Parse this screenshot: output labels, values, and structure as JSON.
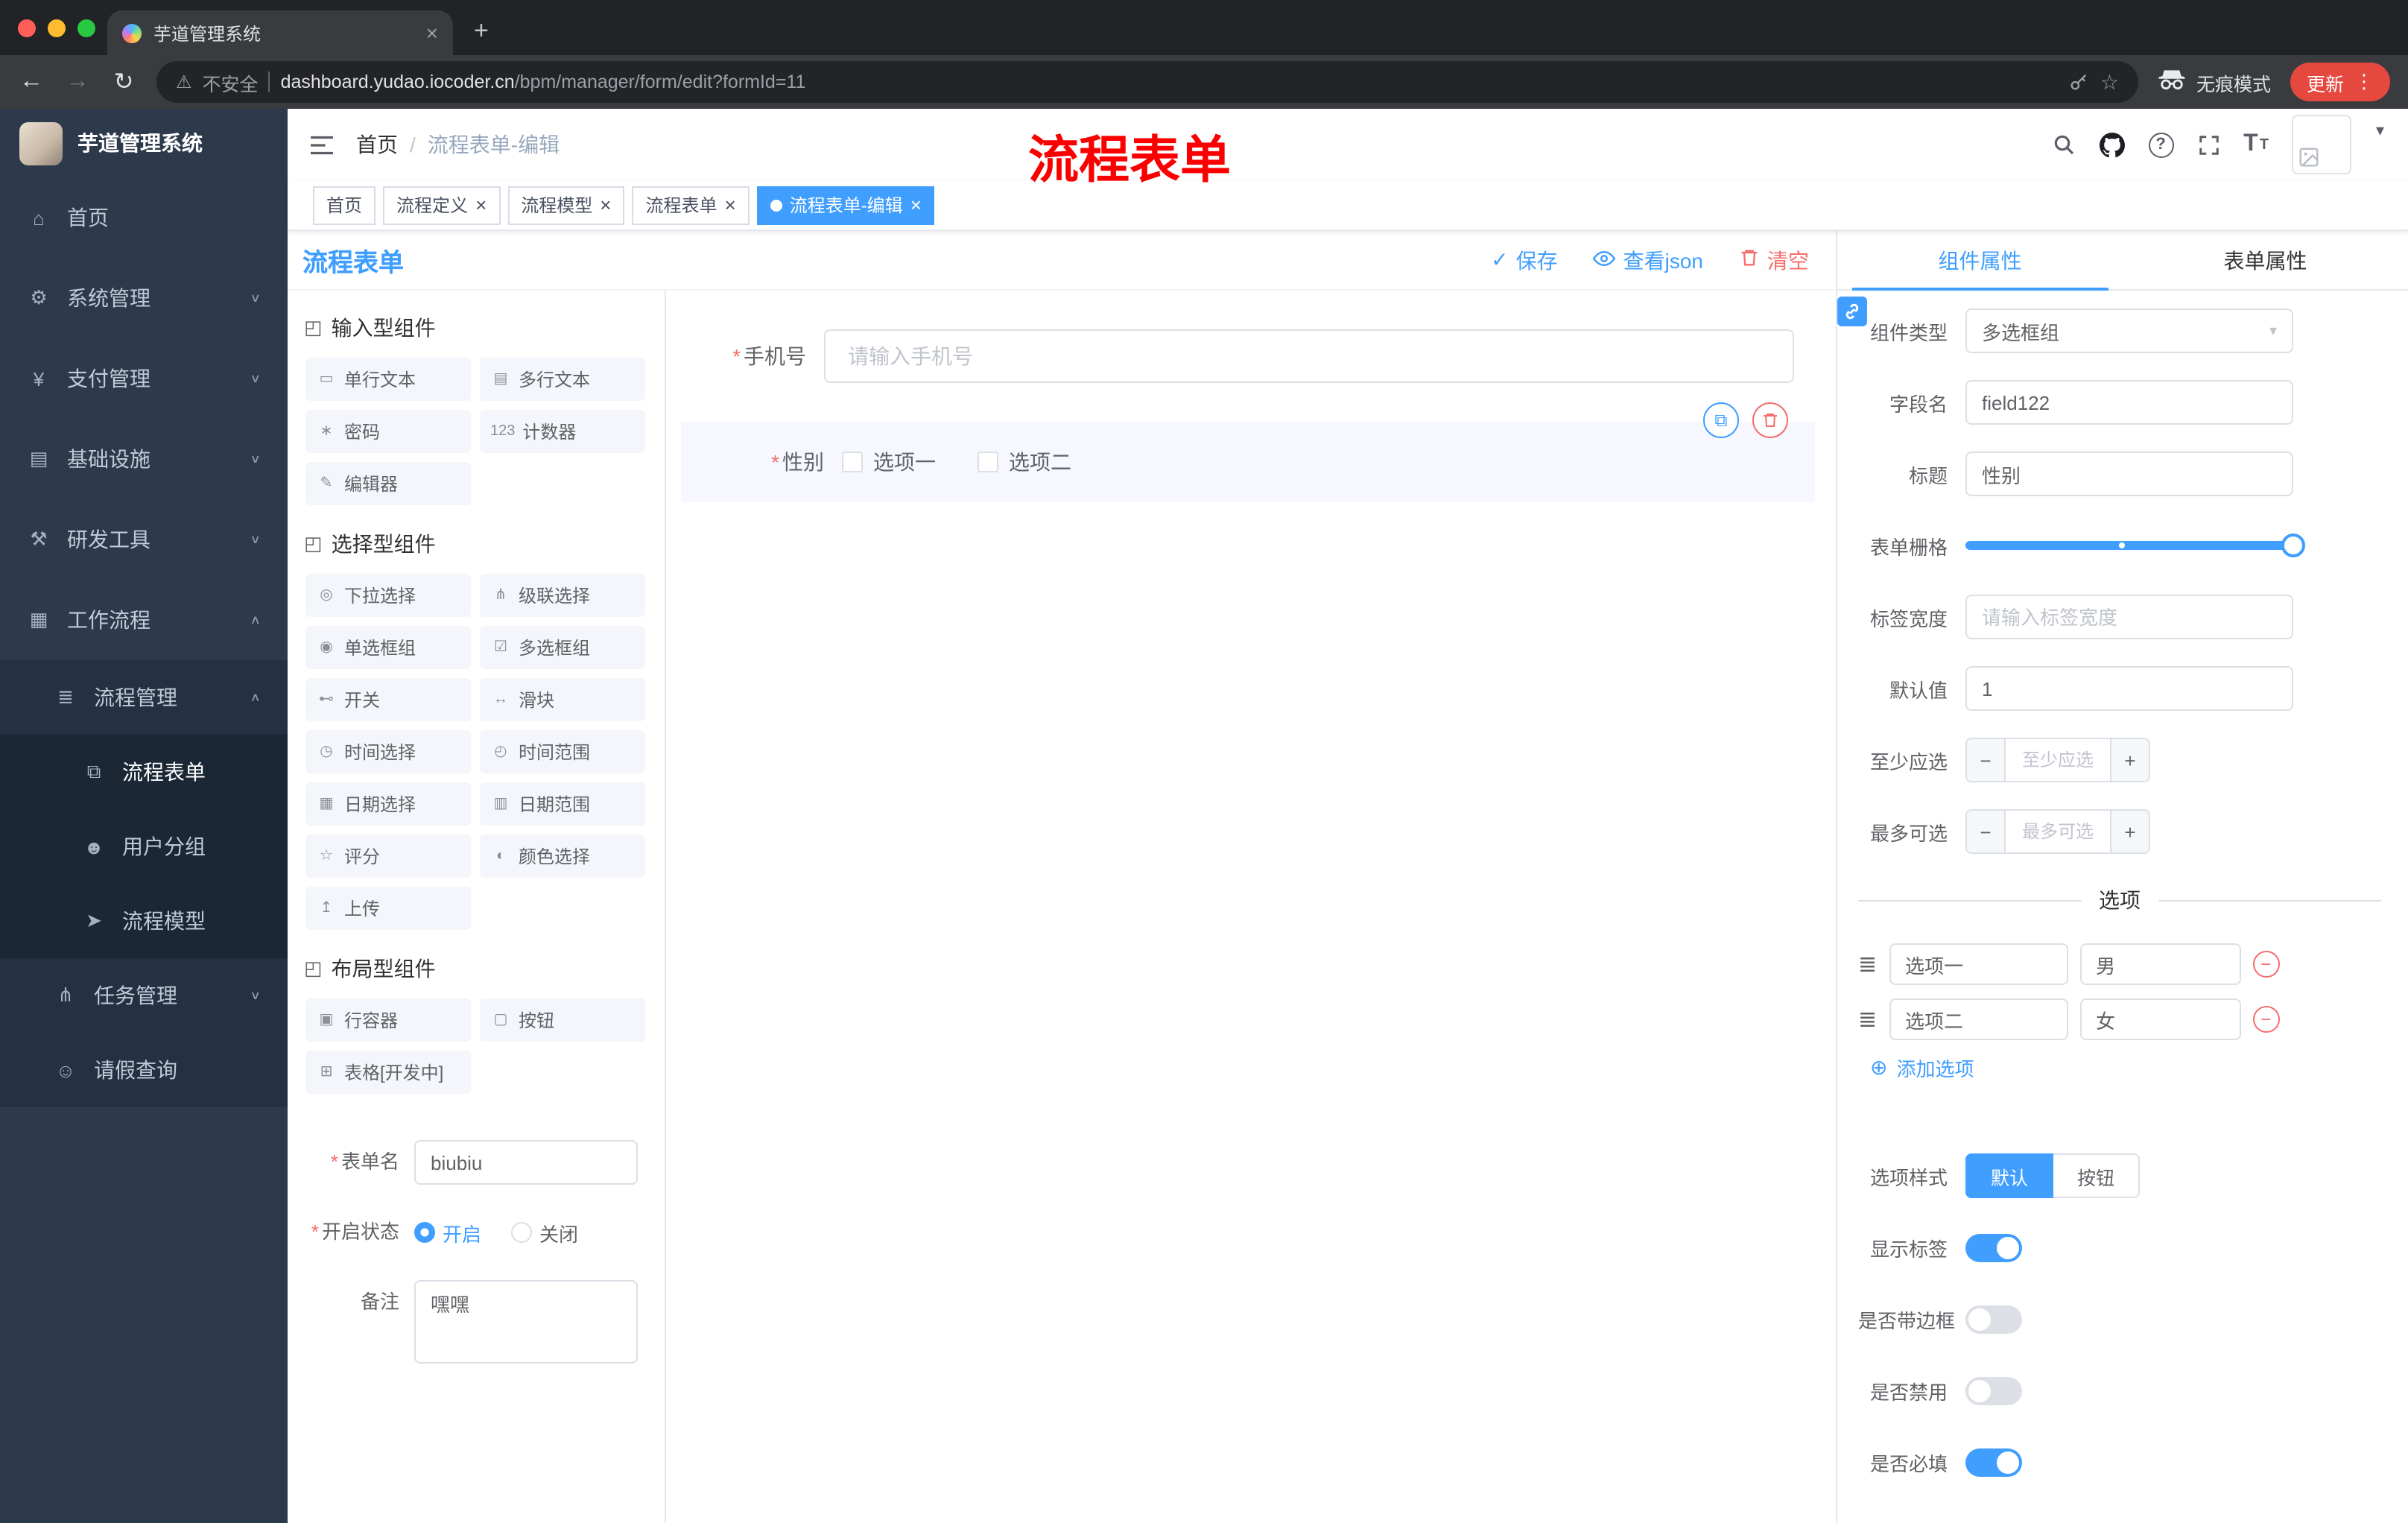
{
  "colors": {
    "accent": "#409eff",
    "danger": "#f56c6c",
    "overlay_red": "#fb0000"
  },
  "symbols": {
    "required": "*",
    "close": "×",
    "plus": "+",
    "minus": "−",
    "dots": "⋮",
    "warning": "⚠",
    "star": "☆",
    "back": "←",
    "forward": "→",
    "reload": "↻",
    "caret": "▾",
    "check": "✓",
    "question": "?",
    "font_big": "T",
    "font_small": "T",
    "chevron_down": "∨",
    "chevron_up": "∧",
    "add_circle": "⊕",
    "drag": "≣",
    "copy": "⧉",
    "select_arrow": "▾"
  },
  "browser": {
    "tab_title": "芋道管理系统",
    "security_label": "不安全",
    "url_host": "dashboard.yudao.iocoder.cn",
    "url_path": "/bpm/manager/form/edit?formId=11",
    "incognito_label": "无痕模式",
    "update_label": "更新"
  },
  "sidebar": {
    "logo_title": "芋道管理系统",
    "menu": [
      {
        "label": "首页",
        "icon": "home",
        "level": 0
      },
      {
        "label": "系统管理",
        "icon": "gear",
        "level": 0,
        "arrow": "down"
      },
      {
        "label": "支付管理",
        "icon": "payment",
        "level": 0,
        "arrow": "down"
      },
      {
        "label": "基础设施",
        "icon": "infrastructure",
        "level": 0,
        "arrow": "down"
      },
      {
        "label": "研发工具",
        "icon": "devtools",
        "level": 0,
        "arrow": "down"
      },
      {
        "label": "工作流程",
        "icon": "workflow",
        "level": 0,
        "arrow": "up"
      },
      {
        "label": "流程管理",
        "icon": "process-management",
        "level": 1,
        "arrow": "up"
      },
      {
        "label": "流程表单",
        "icon": "process-form",
        "level": 2,
        "active": true
      },
      {
        "label": "用户分组",
        "icon": "user-group",
        "level": 2
      },
      {
        "label": "流程模型",
        "icon": "process-model",
        "level": 2
      },
      {
        "label": "任务管理",
        "icon": "task-management",
        "level": 1,
        "arrow": "down"
      },
      {
        "label": "请假查询",
        "icon": "leave-query",
        "level": 1
      }
    ]
  },
  "navbar": {
    "breadcrumb_root": "首页",
    "breadcrumb_separator": "/",
    "breadcrumb_current": "流程表单-编辑",
    "overlay_title": "流程表单"
  },
  "tags": [
    {
      "label": "首页",
      "closable": false,
      "active": false
    },
    {
      "label": "流程定义",
      "closable": true,
      "active": false
    },
    {
      "label": "流程模型",
      "closable": true,
      "active": false
    },
    {
      "label": "流程表单",
      "closable": true,
      "active": false
    },
    {
      "label": "流程表单-编辑",
      "closable": true,
      "active": true
    }
  ],
  "designer": {
    "title": "流程表单",
    "actions": {
      "save": "保存",
      "view_json": "查看json",
      "clear": "清空"
    },
    "groups": [
      {
        "title": "输入型组件",
        "items": [
          {
            "label": "单行文本",
            "icon": "single-line-text"
          },
          {
            "label": "多行文本",
            "icon": "multi-line-text"
          },
          {
            "label": "密码",
            "icon": "password"
          },
          {
            "label": "计数器",
            "icon": "counter"
          },
          {
            "label": "编辑器",
            "icon": "editor"
          }
        ]
      },
      {
        "title": "选择型组件",
        "items": [
          {
            "label": "下拉选择",
            "icon": "select"
          },
          {
            "label": "级联选择",
            "icon": "cascader"
          },
          {
            "label": "单选框组",
            "icon": "radio-group"
          },
          {
            "label": "多选框组",
            "icon": "checkbox-group"
          },
          {
            "label": "开关",
            "icon": "switch"
          },
          {
            "label": "滑块",
            "icon": "slider"
          },
          {
            "label": "时间选择",
            "icon": "time-picker"
          },
          {
            "label": "时间范围",
            "icon": "time-range"
          },
          {
            "label": "日期选择",
            "icon": "date-picker"
          },
          {
            "label": "日期范围",
            "icon": "date-range"
          },
          {
            "label": "评分",
            "icon": "rate"
          },
          {
            "label": "颜色选择",
            "icon": "color-picker"
          },
          {
            "label": "上传",
            "icon": "upload"
          }
        ]
      },
      {
        "title": "布局型组件",
        "items": [
          {
            "label": "行容器",
            "icon": "row-container"
          },
          {
            "label": "按钮",
            "icon": "button"
          },
          {
            "label": "表格[开发中]",
            "icon": "table"
          }
        ]
      }
    ],
    "meta": {
      "form_name_label": "表单名",
      "form_name_value": "biubiu",
      "status_label": "开启状态",
      "status_on": "开启",
      "status_off": "关闭",
      "status_selected": "开启",
      "remark_label": "备注",
      "remark_value": "嘿嘿"
    },
    "canvas": {
      "phone_label": "手机号",
      "phone_placeholder": "请输入手机号",
      "gender_label": "性别",
      "gender_options": [
        "选项一",
        "选项二"
      ]
    }
  },
  "props": {
    "tab_component": "组件属性",
    "tab_form": "表单属性",
    "active_tab": "组件属性",
    "component_type_label": "组件类型",
    "component_type_value": "多选框组",
    "field_name_label": "字段名",
    "field_name_value": "field122",
    "title_label": "标题",
    "title_value": "性别",
    "grid_label": "表单栅格",
    "label_width_label": "标签宽度",
    "label_width_placeholder": "请输入标签宽度",
    "default_label": "默认值",
    "default_value": "1",
    "min_label": "至少应选",
    "min_placeholder": "至少应选",
    "max_label": "最多可选",
    "max_placeholder": "最多可选",
    "options_divider": "选项",
    "options": [
      {
        "name": "选项一",
        "value": "男"
      },
      {
        "name": "选项二",
        "value": "女"
      }
    ],
    "add_option_label": "添加选项",
    "option_style_label": "选项样式",
    "option_style_default": "默认",
    "option_style_button": "按钮",
    "option_style_active": "默认",
    "switches": [
      {
        "label": "显示标签",
        "on": true
      },
      {
        "label": "是否带边框",
        "on": false
      },
      {
        "label": "是否禁用",
        "on": false
      },
      {
        "label": "是否必填",
        "on": true
      }
    ]
  },
  "icon_glyphs": {
    "home": "⌂",
    "gear": "⚙",
    "payment": "¥",
    "infrastructure": "▤",
    "devtools": "⚒",
    "workflow": "▦",
    "process-management": "≣",
    "process-form": "⧉",
    "user-group": "☻",
    "process-model": "➤",
    "task-management": "⋔",
    "leave-query": "☺",
    "group": "◰",
    "single-line-text": "▭",
    "multi-line-text": "▤",
    "password": "∗",
    "counter": "123",
    "editor": "✎",
    "select": "◎",
    "cascader": "⋔",
    "radio-group": "◉",
    "checkbox-group": "☑",
    "switch": "⊷",
    "slider": "↔",
    "time-picker": "◷",
    "time-range": "◴",
    "date-picker": "▦",
    "date-range": "▥",
    "rate": "☆",
    "color-picker": "◐",
    "upload": "↥",
    "row-container": "▣",
    "button": "▢",
    "table": "⊞"
  }
}
